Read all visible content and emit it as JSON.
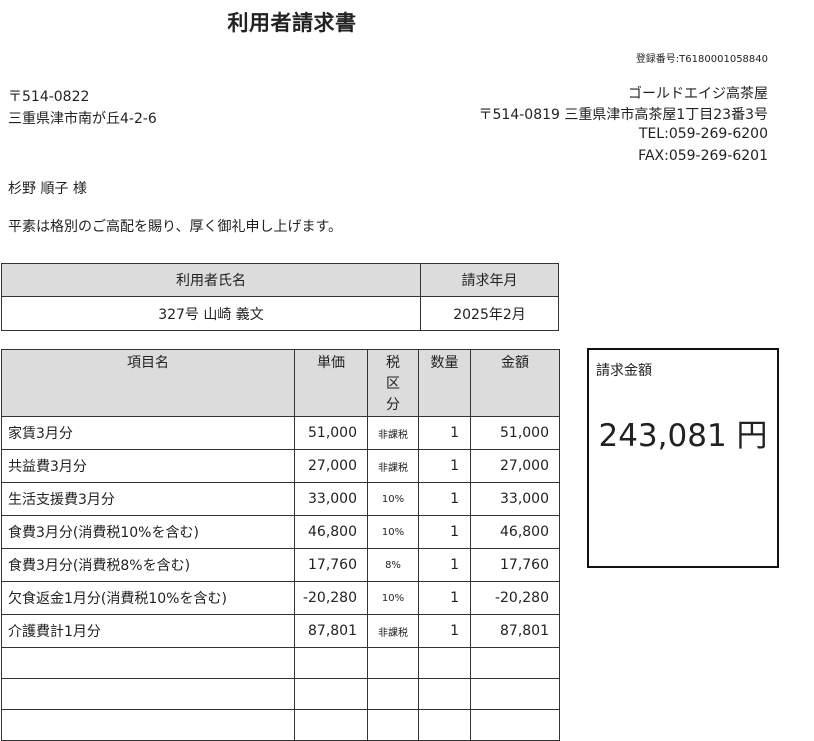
{
  "document": {
    "title": "利用者請求書",
    "registration_no": "登録番号:T6180001058840"
  },
  "recipient": {
    "postal": "〒514-0822",
    "address": "三重県津市南が丘4-2-6",
    "name": "杉野 順子 様"
  },
  "issuer": {
    "name": "ゴールドエイジ高茶屋",
    "address": "〒514-0819 三重県津市高茶屋1丁目23番3号",
    "tel": "TEL:059-269-6200",
    "fax": "FAX:059-269-6201"
  },
  "greeting": "平素は格別のご高配を賜り、厚く御礼申し上げます。",
  "info_table": {
    "headers": [
      "利用者氏名",
      "請求年月"
    ],
    "user_name": "327号 山崎 義文",
    "billing_month": "2025年2月"
  },
  "items_table": {
    "headers": {
      "item": "項目名",
      "unit_price": "単価",
      "tax": "税区分",
      "qty": "数量",
      "amount": "金額"
    },
    "rows": [
      {
        "name": "家賃3月分",
        "price": "51,000",
        "tax": "非課税",
        "qty": "1",
        "amount": "51,000"
      },
      {
        "name": "共益費3月分",
        "price": "27,000",
        "tax": "非課税",
        "qty": "1",
        "amount": "27,000"
      },
      {
        "name": "生活支援費3月分",
        "price": "33,000",
        "tax": "10%",
        "qty": "1",
        "amount": "33,000"
      },
      {
        "name": "食費3月分(消費税10%を含む)",
        "price": "46,800",
        "tax": "10%",
        "qty": "1",
        "amount": "46,800"
      },
      {
        "name": "食費3月分(消費税8%を含む)",
        "price": "17,760",
        "tax": "8%",
        "qty": "1",
        "amount": "17,760"
      },
      {
        "name": "欠食返金1月分(消費税10%を含む)",
        "price": "-20,280",
        "tax": "10%",
        "qty": "1",
        "amount": "-20,280"
      },
      {
        "name": "介護費計1月分",
        "price": "87,801",
        "tax": "非課税",
        "qty": "1",
        "amount": "87,801"
      }
    ]
  },
  "total": {
    "label": "請求金額",
    "amount": "243,081 円"
  }
}
